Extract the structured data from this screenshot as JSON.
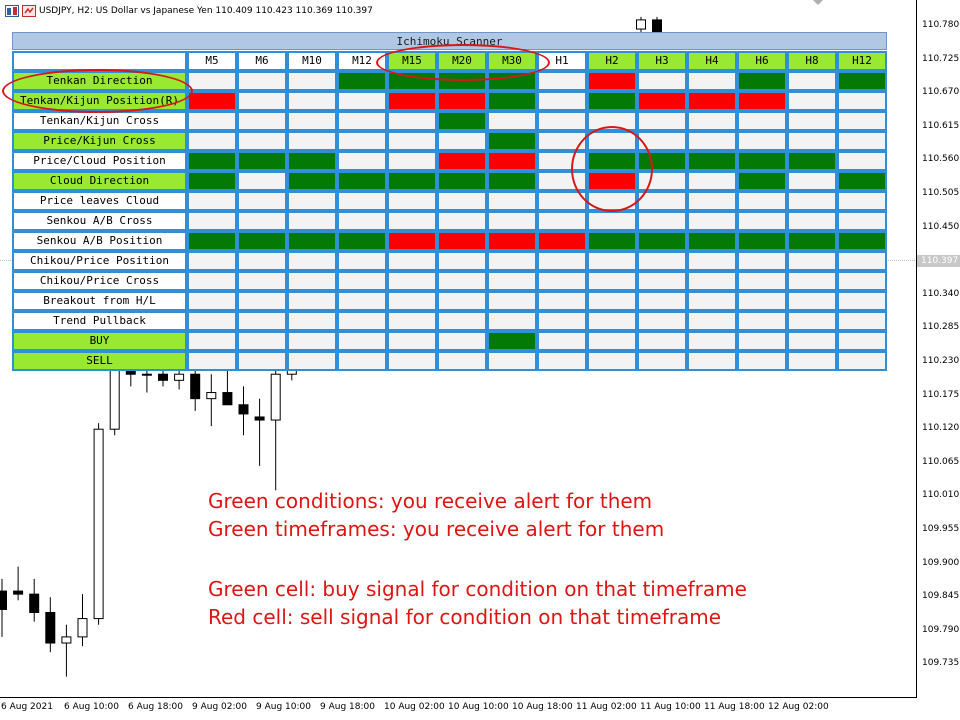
{
  "window": {
    "title": "USDJPY, H2:  US Dollar vs Japanese Yen  110.409 110.423 110.369 110.397"
  },
  "price_axis": {
    "labels": [
      "110.780",
      "110.725",
      "110.670",
      "110.615",
      "110.560",
      "110.505",
      "110.450",
      "110.397",
      "110.340",
      "110.285",
      "110.230",
      "110.175",
      "110.120",
      "110.065",
      "110.010",
      "109.955",
      "109.900",
      "109.845",
      "109.790",
      "109.735"
    ],
    "current_price": "110.397"
  },
  "time_axis": {
    "labels": [
      "6 Aug 2021",
      "6 Aug 10:00",
      "6 Aug 18:00",
      "9 Aug 02:00",
      "9 Aug 10:00",
      "9 Aug 18:00",
      "10 Aug 02:00",
      "10 Aug 10:00",
      "10 Aug 18:00",
      "11 Aug 02:00",
      "11 Aug 10:00",
      "11 Aug 18:00",
      "12 Aug 02:00"
    ]
  },
  "colors": {
    "buy": "#047a04",
    "sell": "#fb0000",
    "enabled": "#99e832",
    "border": "#2f8fd8",
    "annotation": "#e11414"
  },
  "scanner": {
    "title": "Ichimoku Scanner",
    "timeframes": [
      {
        "label": "M5",
        "enabled": false
      },
      {
        "label": "M6",
        "enabled": false
      },
      {
        "label": "M10",
        "enabled": false
      },
      {
        "label": "M12",
        "enabled": false
      },
      {
        "label": "M15",
        "enabled": true
      },
      {
        "label": "M20",
        "enabled": true
      },
      {
        "label": "M30",
        "enabled": true
      },
      {
        "label": "H1",
        "enabled": false
      },
      {
        "label": "H2",
        "enabled": true
      },
      {
        "label": "H3",
        "enabled": true
      },
      {
        "label": "H4",
        "enabled": true
      },
      {
        "label": "H6",
        "enabled": true
      },
      {
        "label": "H8",
        "enabled": true
      },
      {
        "label": "H12",
        "enabled": true
      }
    ],
    "conditions": [
      {
        "label": "Tenkan Direction",
        "enabled": true,
        "cells": [
          "",
          "",
          "",
          "B",
          "B",
          "B",
          "B",
          "",
          "S",
          "",
          "",
          "B",
          "",
          "B"
        ]
      },
      {
        "label": "Tenkan/Kijun Position(R)",
        "enabled": true,
        "cells": [
          "S",
          "",
          "",
          "",
          "S",
          "S",
          "B",
          "",
          "B",
          "S",
          "S",
          "S",
          "",
          ""
        ]
      },
      {
        "label": "Tenkan/Kijun Cross",
        "enabled": false,
        "cells": [
          "",
          "",
          "",
          "",
          "",
          "B",
          "",
          "",
          "",
          "",
          "",
          "",
          "",
          ""
        ]
      },
      {
        "label": "Price/Kijun Cross",
        "enabled": true,
        "cells": [
          "",
          "",
          "",
          "",
          "",
          "",
          "B",
          "",
          "",
          "",
          "",
          "",
          "",
          ""
        ]
      },
      {
        "label": "Price/Cloud Position",
        "enabled": false,
        "cells": [
          "B",
          "B",
          "B",
          "",
          "",
          "S",
          "S",
          "",
          "B",
          "B",
          "B",
          "B",
          "B",
          ""
        ]
      },
      {
        "label": "Cloud Direction",
        "enabled": true,
        "cells": [
          "B",
          "",
          "B",
          "B",
          "B",
          "B",
          "B",
          "",
          "S",
          "",
          "",
          "B",
          "",
          "B"
        ]
      },
      {
        "label": "Price leaves Cloud",
        "enabled": false,
        "cells": [
          "",
          "",
          "",
          "",
          "",
          "",
          "",
          "",
          "",
          "",
          "",
          "",
          "",
          ""
        ]
      },
      {
        "label": "Senkou A/B Cross",
        "enabled": false,
        "cells": [
          "",
          "",
          "",
          "",
          "",
          "",
          "",
          "",
          "",
          "",
          "",
          "",
          "",
          ""
        ]
      },
      {
        "label": "Senkou A/B Position",
        "enabled": false,
        "cells": [
          "B",
          "B",
          "B",
          "B",
          "S",
          "S",
          "S",
          "S",
          "B",
          "B",
          "B",
          "B",
          "B",
          "B"
        ]
      },
      {
        "label": "Chikou/Price Position",
        "enabled": false,
        "cells": [
          "",
          "",
          "",
          "",
          "",
          "",
          "",
          "",
          "",
          "",
          "",
          "",
          "",
          ""
        ]
      },
      {
        "label": "Chikou/Price Cross",
        "enabled": false,
        "cells": [
          "",
          "",
          "",
          "",
          "",
          "",
          "",
          "",
          "",
          "",
          "",
          "",
          "",
          ""
        ]
      },
      {
        "label": "Breakout from H/L",
        "enabled": false,
        "cells": [
          "",
          "",
          "",
          "",
          "",
          "",
          "",
          "",
          "",
          "",
          "",
          "",
          "",
          ""
        ]
      },
      {
        "label": "Trend Pullback",
        "enabled": false,
        "cells": [
          "",
          "",
          "",
          "",
          "",
          "",
          "",
          "",
          "",
          "",
          "",
          "",
          "",
          ""
        ]
      },
      {
        "label": "BUY",
        "enabled": true,
        "cells": [
          "",
          "",
          "",
          "",
          "",
          "",
          "B",
          "",
          "",
          "",
          "",
          "",
          "",
          ""
        ]
      },
      {
        "label": "SELL",
        "enabled": true,
        "cells": [
          "",
          "",
          "",
          "",
          "",
          "",
          "",
          "",
          "",
          "",
          "",
          "",
          "",
          ""
        ]
      }
    ]
  },
  "notes": {
    "line1": "Green conditions: you receive alert for them",
    "line2": "Green timeframes: you receive alert for them",
    "line3": "Green cell: buy signal for condition on that timeframe",
    "line4": "Red cell: sell signal for condition on that timeframe"
  },
  "candles": [
    {
      "o": 109.855,
      "h": 109.875,
      "l": 109.78,
      "c": 109.825
    },
    {
      "o": 109.855,
      "h": 109.895,
      "l": 109.84,
      "c": 109.85
    },
    {
      "o": 109.85,
      "h": 109.875,
      "l": 109.805,
      "c": 109.82
    },
    {
      "o": 109.82,
      "h": 109.845,
      "l": 109.755,
      "c": 109.77
    },
    {
      "o": 109.77,
      "h": 109.8,
      "l": 109.715,
      "c": 109.78
    },
    {
      "o": 109.78,
      "h": 109.85,
      "l": 109.765,
      "c": 109.81
    },
    {
      "o": 109.81,
      "h": 110.13,
      "l": 109.8,
      "c": 110.12
    },
    {
      "o": 110.12,
      "h": 110.33,
      "l": 110.11,
      "c": 110.32
    },
    {
      "o": 110.32,
      "h": 110.34,
      "l": 110.19,
      "c": 110.21
    },
    {
      "o": 110.21,
      "h": 110.26,
      "l": 110.18,
      "c": 110.21
    },
    {
      "o": 110.21,
      "h": 110.245,
      "l": 110.19,
      "c": 110.2
    },
    {
      "o": 110.2,
      "h": 110.24,
      "l": 110.185,
      "c": 110.21
    },
    {
      "o": 110.21,
      "h": 110.23,
      "l": 110.15,
      "c": 110.17
    },
    {
      "o": 110.17,
      "h": 110.21,
      "l": 110.125,
      "c": 110.18
    },
    {
      "o": 110.18,
      "h": 110.23,
      "l": 110.16,
      "c": 110.16
    },
    {
      "o": 110.16,
      "h": 110.19,
      "l": 110.11,
      "c": 110.145
    },
    {
      "o": 110.14,
      "h": 110.17,
      "l": 110.06,
      "c": 110.135
    },
    {
      "o": 110.135,
      "h": 110.22,
      "l": 110.02,
      "c": 110.21
    },
    {
      "o": 110.21,
      "h": 110.25,
      "l": 110.2,
      "c": 110.23
    }
  ],
  "top_candles": [
    {
      "o": 110.775,
      "h": 110.795,
      "l": 110.765,
      "c": 110.79
    },
    {
      "o": 110.79,
      "h": 110.795,
      "l": 110.76,
      "c": 110.77
    }
  ]
}
